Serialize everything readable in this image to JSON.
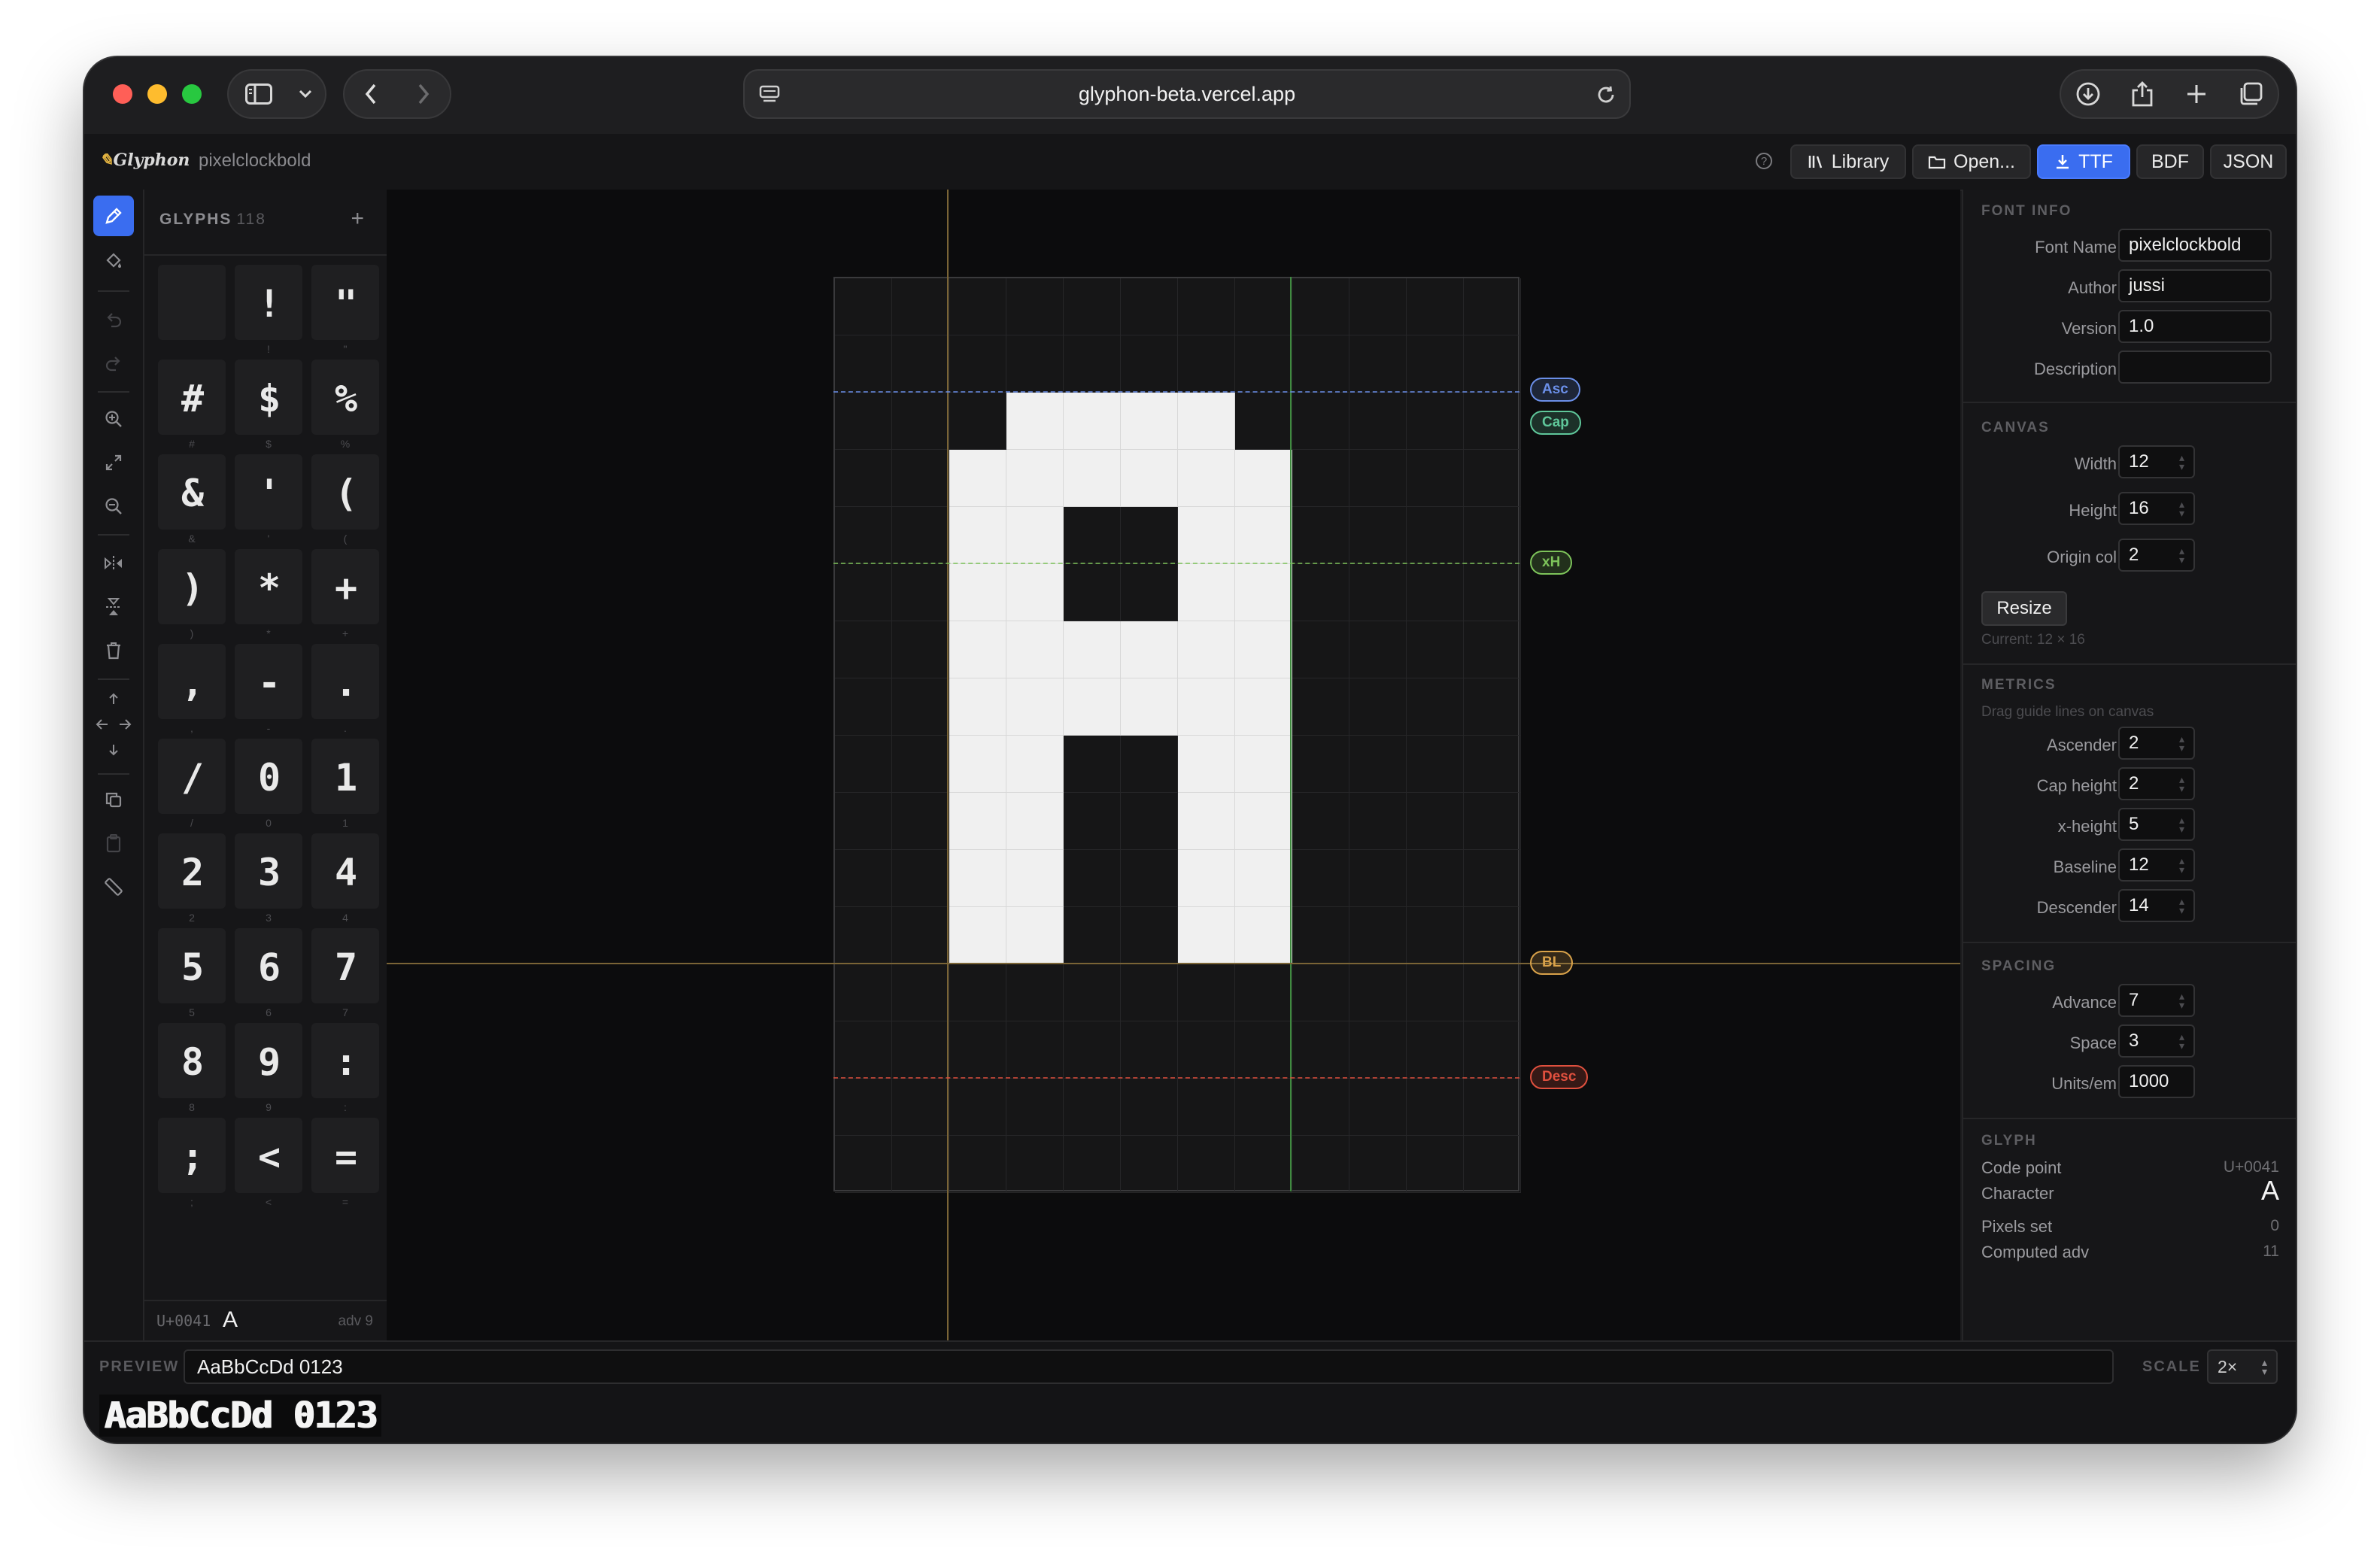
{
  "browser": {
    "url": "glyphon-beta.vercel.app"
  },
  "app": {
    "logo": "Glyphon",
    "font_name": "pixelclockbold",
    "buttons": {
      "library": "Library",
      "open": "Open...",
      "ttf": "TTF",
      "bdf": "BDF",
      "json": "JSON"
    },
    "accent_color": "#3a6df0"
  },
  "tools": [
    "pencil-icon",
    "paint-bucket-icon",
    "undo-icon",
    "redo-icon",
    "zoom-in-icon",
    "fit-icon",
    "zoom-out-icon",
    "flip-horizontal-icon",
    "flip-vertical-icon",
    "trash-icon",
    "move-up-icon",
    "move-horizontal-icon",
    "move-down-icon",
    "copy-icon",
    "paste-icon",
    "ruler-icon"
  ],
  "glyphs": {
    "title": "GLYPHS",
    "count": "118",
    "add": "+",
    "items": [
      {
        "pix": "",
        "label": " "
      },
      {
        "pix": "!",
        "label": "!"
      },
      {
        "pix": "\"",
        "label": "\""
      },
      {
        "pix": "#",
        "label": "#"
      },
      {
        "pix": "$",
        "label": "$"
      },
      {
        "pix": "%",
        "label": "%"
      },
      {
        "pix": "&",
        "label": "&"
      },
      {
        "pix": "'",
        "label": "'"
      },
      {
        "pix": "(",
        "label": "("
      },
      {
        "pix": ")",
        "label": ")"
      },
      {
        "pix": "*",
        "label": "*"
      },
      {
        "pix": "+",
        "label": "+"
      },
      {
        "pix": ",",
        "label": ","
      },
      {
        "pix": "-",
        "label": "-"
      },
      {
        "pix": ".",
        "label": "."
      },
      {
        "pix": "/",
        "label": "/"
      },
      {
        "pix": "0",
        "label": "0"
      },
      {
        "pix": "1",
        "label": "1"
      },
      {
        "pix": "2",
        "label": "2"
      },
      {
        "pix": "3",
        "label": "3"
      },
      {
        "pix": "4",
        "label": "4"
      },
      {
        "pix": "5",
        "label": "5"
      },
      {
        "pix": "6",
        "label": "6"
      },
      {
        "pix": "7",
        "label": "7"
      },
      {
        "pix": "8",
        "label": "8"
      },
      {
        "pix": "9",
        "label": "9"
      },
      {
        "pix": ":",
        "label": ":"
      },
      {
        "pix": ";",
        "label": ";"
      },
      {
        "pix": "<",
        "label": "<"
      },
      {
        "pix": "=",
        "label": "="
      }
    ],
    "footer": {
      "code": "U+0041",
      "char": "A",
      "adv": "adv 9"
    }
  },
  "canvas": {
    "cols": 12,
    "rows": 16,
    "pixels_on": [
      [
        2,
        3
      ],
      [
        2,
        4
      ],
      [
        2,
        5
      ],
      [
        2,
        6
      ],
      [
        3,
        2
      ],
      [
        3,
        3
      ],
      [
        3,
        4
      ],
      [
        3,
        5
      ],
      [
        3,
        6
      ],
      [
        3,
        7
      ],
      [
        4,
        2
      ],
      [
        4,
        3
      ],
      [
        4,
        6
      ],
      [
        4,
        7
      ],
      [
        5,
        2
      ],
      [
        5,
        3
      ],
      [
        5,
        6
      ],
      [
        5,
        7
      ],
      [
        6,
        2
      ],
      [
        6,
        3
      ],
      [
        6,
        4
      ],
      [
        6,
        5
      ],
      [
        6,
        6
      ],
      [
        6,
        7
      ],
      [
        7,
        2
      ],
      [
        7,
        3
      ],
      [
        7,
        4
      ],
      [
        7,
        5
      ],
      [
        7,
        6
      ],
      [
        7,
        7
      ],
      [
        8,
        2
      ],
      [
        8,
        3
      ],
      [
        8,
        6
      ],
      [
        8,
        7
      ],
      [
        9,
        2
      ],
      [
        9,
        3
      ],
      [
        9,
        6
      ],
      [
        9,
        7
      ],
      [
        10,
        2
      ],
      [
        10,
        3
      ],
      [
        10,
        6
      ],
      [
        10,
        7
      ],
      [
        11,
        2
      ],
      [
        11,
        3
      ],
      [
        11,
        6
      ],
      [
        11,
        7
      ]
    ],
    "guides": {
      "asc": {
        "label": "Asc",
        "row": 2,
        "color": "#6b8fe8"
      },
      "cap": {
        "label": "Cap",
        "row": 2,
        "color": "#5fc79a"
      },
      "xh": {
        "label": "xH",
        "row": 5,
        "color": "#7dc35a"
      },
      "bl": {
        "label": "BL",
        "row": 12,
        "color": "#d9a24a"
      },
      "desc": {
        "label": "Desc",
        "row": 14,
        "color": "#e0503e"
      }
    }
  },
  "font_info": {
    "title": "FONT INFO",
    "font_name_label": "Font Name",
    "font_name": "pixelclockbold",
    "author_label": "Author",
    "author": "jussi",
    "version_label": "Version",
    "version": "1.0",
    "description_label": "Description",
    "description": ""
  },
  "canvas_settings": {
    "title": "CANVAS",
    "width_label": "Width",
    "width": "12",
    "height_label": "Height",
    "height": "16",
    "origin_label": "Origin col",
    "origin": "2",
    "resize": "Resize",
    "current": "Current: 12 × 16"
  },
  "metrics": {
    "title": "METRICS",
    "hint": "Drag guide lines on canvas",
    "ascender_label": "Ascender",
    "ascender": "2",
    "cap_label": "Cap height",
    "cap": "2",
    "xheight_label": "x-height",
    "xheight": "5",
    "baseline_label": "Baseline",
    "baseline": "12",
    "descender_label": "Descender",
    "descender": "14"
  },
  "spacing": {
    "title": "SPACING",
    "advance_label": "Advance",
    "advance": "7",
    "space_label": "Space",
    "space": "3",
    "units_label": "Units/em",
    "units": "1000"
  },
  "glyph_info": {
    "title": "GLYPH",
    "codepoint_label": "Code point",
    "codepoint": "U+0041",
    "character_label": "Character",
    "character": "A",
    "pixels_label": "Pixels set",
    "pixels": "0",
    "adv_label": "Computed adv",
    "adv": "11"
  },
  "preview": {
    "label": "PREVIEW",
    "text": "AaBbCcDd 0123",
    "scale_label": "SCALE",
    "scale": "2×",
    "render": "AaBbCcDd 0123"
  }
}
